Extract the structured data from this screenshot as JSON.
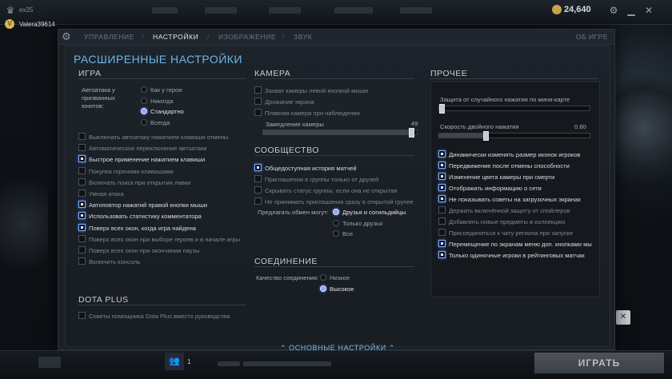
{
  "topbar": {
    "left_label": "ex25",
    "currency": "24,640",
    "username": "Valera39614",
    "avatar_letter": "V"
  },
  "tabs": {
    "items": [
      "УПРАВЛЕНИЕ",
      "НАСТРОЙКИ",
      "ИЗОБРАЖЕНИЕ",
      "ЗВУК"
    ],
    "active": "НАСТРОЙКИ",
    "about": "ОБ ИГРЕ"
  },
  "page_title": "РАСШИРЕННЫЕ НАСТРОЙКИ",
  "game": {
    "title": "ИГРА",
    "autoattack_label": "Автоатака у призванных юнитов:",
    "autoattack_options": [
      "Как у героя",
      "Никогда",
      "Стандартно",
      "Всегда"
    ],
    "autoattack_selected": "Стандартно",
    "checkboxes": [
      {
        "label": "Выключать автоатаку нажатием клавиши отмены",
        "checked": false
      },
      {
        "label": "Автоматическое переключение автоатаки",
        "checked": false
      },
      {
        "label": "Быстрое применение нажатием клавиши",
        "checked": true
      },
      {
        "label": "Покупка горячими клавишами",
        "checked": false
      },
      {
        "label": "Включать поиск при открытии лавки",
        "checked": false
      },
      {
        "label": "Умная атака",
        "checked": false
      },
      {
        "label": "Автоповтор нажатий правой кнопки мыши",
        "checked": true
      },
      {
        "label": "Использовать статистику комментатора",
        "checked": true
      },
      {
        "label": "Поверх всех окон, когда игра найдена",
        "checked": true
      },
      {
        "label": "Поверх всех окон при выборе героев и в начале игры",
        "checked": false
      },
      {
        "label": "Поверх всех окон при окончании паузы",
        "checked": false
      },
      {
        "label": "Включить консоль",
        "checked": false
      }
    ]
  },
  "dota_plus": {
    "title": "DOTA PLUS",
    "checkboxes": [
      {
        "label": "Советы помощника Dota Plus вместо руководства",
        "checked": false
      }
    ]
  },
  "camera": {
    "title": "КАМЕРА",
    "checkboxes": [
      {
        "label": "Захват камеры левой кнопкой мыши",
        "checked": false
      },
      {
        "label": "Дрожание экрана",
        "checked": false
      },
      {
        "label": "Плавная камера при наблюдении",
        "checked": false
      }
    ],
    "slowdown_label": "Замедление камеры",
    "slowdown_value": "49",
    "slowdown_fraction": 0.98
  },
  "community": {
    "title": "СООБЩЕСТВО",
    "checkboxes": [
      {
        "label": "Общедоступная история матчей",
        "checked": true
      },
      {
        "label": "Приглашения в группы только от друзей",
        "checked": false
      },
      {
        "label": "Скрывать статус группы, если она не открытая",
        "checked": false
      },
      {
        "label": "Не принимать приглашения сразу в открытой группе",
        "checked": false
      }
    ],
    "trade_label": "Предлагать обмен могут:",
    "trade_options": [
      "Друзья и согильдийцы",
      "Только друзья",
      "Все"
    ],
    "trade_selected": "Друзья и согильдийцы"
  },
  "connection": {
    "title": "СОЕДИНЕНИЕ",
    "quality_label": "Качество соединения:",
    "quality_options": [
      "Низкое",
      "Высокое"
    ],
    "quality_selected": "Высокое"
  },
  "other": {
    "title": "ПРОЧЕЕ",
    "minimap_label": "Защита от случайного нажатия по мини-карте",
    "minimap_fraction": 0.0,
    "doubletap_label": "Скорость двойного нажатия",
    "doubletap_value": "0.60",
    "doubletap_fraction": 0.3,
    "checkboxes": [
      {
        "label": "Динамически изменять размер иконок игроков",
        "checked": true
      },
      {
        "label": "Передвижение после отмены способности",
        "checked": true
      },
      {
        "label": "Изменение цвета камеры при смерти",
        "checked": true
      },
      {
        "label": "Отображать информацию о сети",
        "checked": true
      },
      {
        "label": "Не показывать советы на загрузочных экранах",
        "checked": true
      },
      {
        "label": "Держать включённой защиту от спойлеров",
        "checked": false
      },
      {
        "label": "Добавлять новые предметы в коллекцию",
        "checked": false
      },
      {
        "label": "Присоединяться к чату региона при запуске",
        "checked": false
      },
      {
        "label": "Перемещение по экранам меню доп. кнопками мы",
        "checked": true
      },
      {
        "label": "Только одиночные игроки в рейтинговых матчах",
        "checked": true
      }
    ]
  },
  "bottom_link": "ОСНОВНЫЕ НАСТРОЙКИ",
  "bottombar": {
    "party_count": "1",
    "play_label": "ИГРАТЬ"
  }
}
